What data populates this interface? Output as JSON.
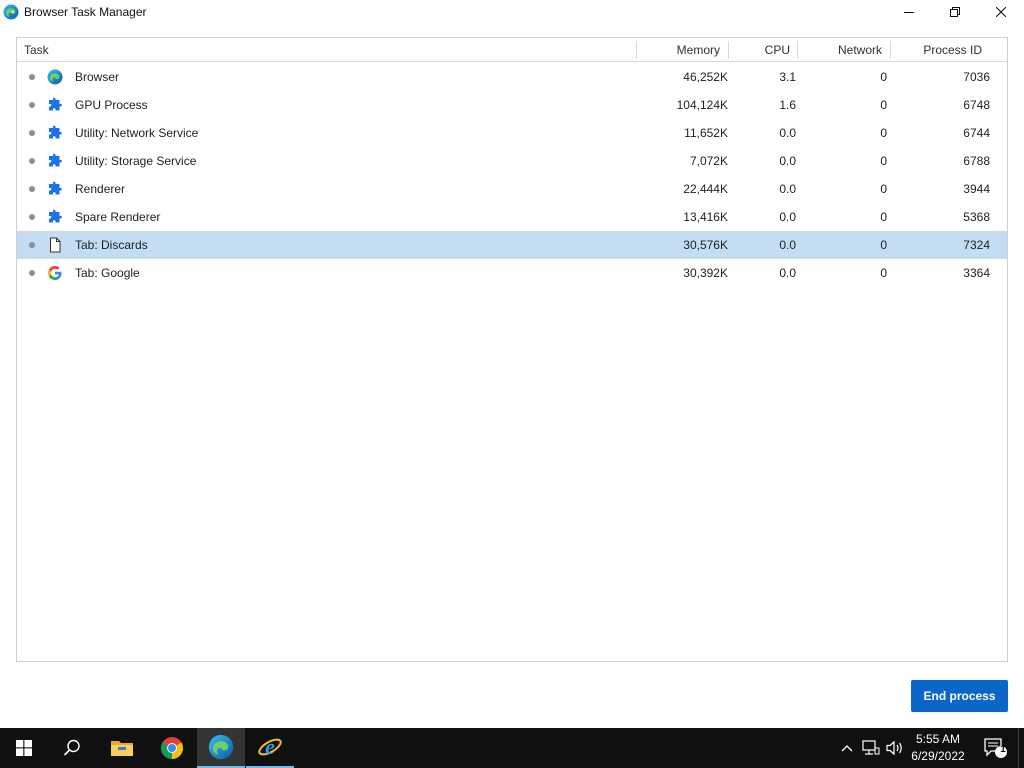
{
  "window": {
    "title": "Browser Task Manager",
    "app_icon": "edge-icon",
    "controls": [
      "minimize-icon",
      "restore-icon",
      "close-icon"
    ]
  },
  "table": {
    "columns": {
      "task": "Task",
      "memory": "Memory",
      "cpu": "CPU",
      "network": "Network",
      "pid": "Process ID"
    },
    "rows": [
      {
        "icon": "edge-icon",
        "task": "Browser",
        "memory": "46,252K",
        "cpu": "3.1",
        "network": "0",
        "pid": "7036",
        "selected": false
      },
      {
        "icon": "puzzle-icon",
        "task": "GPU Process",
        "memory": "104,124K",
        "cpu": "1.6",
        "network": "0",
        "pid": "6748",
        "selected": false
      },
      {
        "icon": "puzzle-icon",
        "task": "Utility: Network Service",
        "memory": "11,652K",
        "cpu": "0.0",
        "network": "0",
        "pid": "6744",
        "selected": false
      },
      {
        "icon": "puzzle-icon",
        "task": "Utility: Storage Service",
        "memory": "7,072K",
        "cpu": "0.0",
        "network": "0",
        "pid": "6788",
        "selected": false
      },
      {
        "icon": "puzzle-icon",
        "task": "Renderer",
        "memory": "22,444K",
        "cpu": "0.0",
        "network": "0",
        "pid": "3944",
        "selected": false
      },
      {
        "icon": "puzzle-icon",
        "task": "Spare Renderer",
        "memory": "13,416K",
        "cpu": "0.0",
        "network": "0",
        "pid": "5368",
        "selected": false
      },
      {
        "icon": "document-icon",
        "task": "Tab: Discards",
        "memory": "30,576K",
        "cpu": "0.0",
        "network": "0",
        "pid": "7324",
        "selected": true
      },
      {
        "icon": "google-icon",
        "task": "Tab: Google",
        "memory": "30,392K",
        "cpu": "0.0",
        "network": "0",
        "pid": "3364",
        "selected": false
      }
    ]
  },
  "actions": {
    "end_process": "End process"
  },
  "taskbar": {
    "apps": [
      "windows-start-icon",
      "search-icon",
      "file-explorer-icon",
      "chrome-icon",
      "edge-icon",
      "internet-explorer-icon"
    ],
    "tray_icons": [
      "chevron-up-icon",
      "network-icon",
      "volume-icon"
    ],
    "time": "5:55 AM",
    "date": "6/29/2022",
    "notification_count": "1"
  },
  "colors": {
    "accent": "#0a66c9",
    "selected_row": "#c5ddf3",
    "taskbar": "#101010",
    "puzzle_icon": "#1a73e8"
  }
}
